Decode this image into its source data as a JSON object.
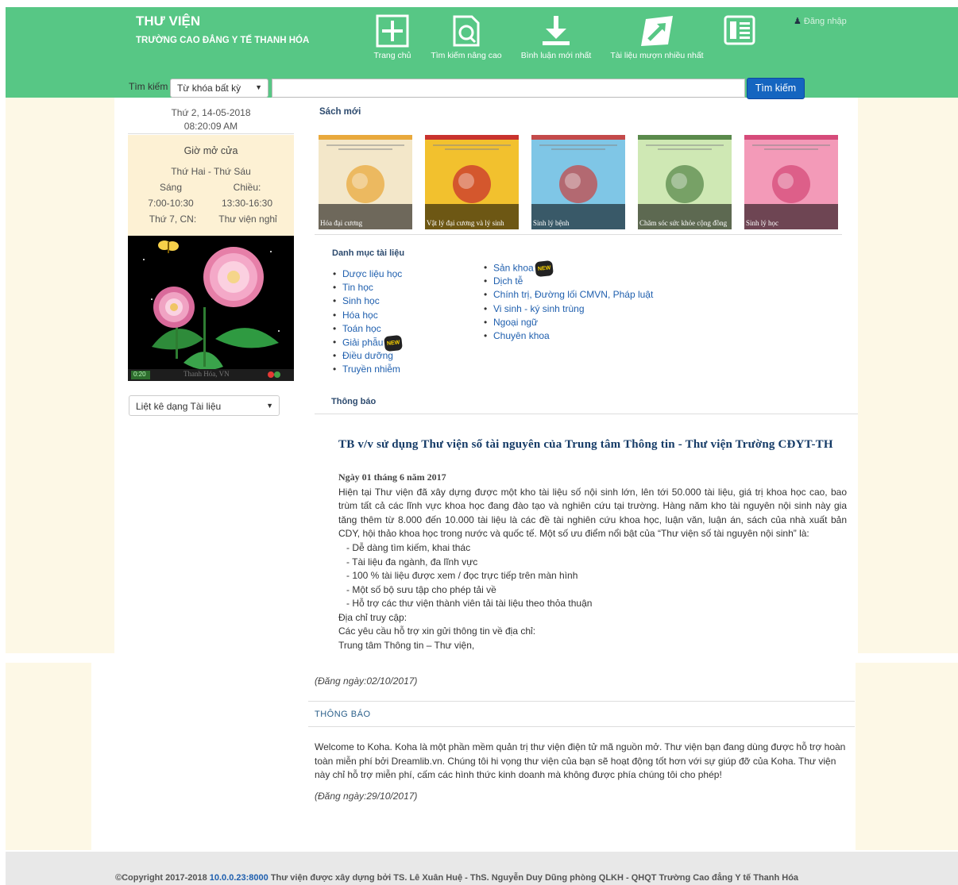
{
  "header": {
    "title": "THƯ VIỆN",
    "subtitle": "TRƯỜNG CAO ĐẲNG Y TẾ THANH HÓA",
    "nav": [
      {
        "label": "Trang chủ",
        "icon": "home-plus-icon"
      },
      {
        "label": "Tìm kiếm nâng cao",
        "icon": "advanced-search-icon"
      },
      {
        "label": "Bình luận mới nhất",
        "icon": "download-icon"
      },
      {
        "label": "Tài liệu mượn nhiều nhất",
        "icon": "trending-arrow-icon"
      },
      {
        "label": "",
        "icon": "newspaper-icon"
      }
    ],
    "login": "Đăng nhập"
  },
  "search": {
    "label": "Tìm kiếm",
    "scope": "Từ khóa bất kỳ",
    "query": "",
    "button": "Tìm kiếm"
  },
  "sidebar": {
    "date": "Thứ 2, 14-05-2018",
    "time": "08:20:09 AM",
    "hours_title": "Giờ mở cửa",
    "weekdays": "Thứ Hai - Thứ Sáu",
    "morning_label": "Sáng",
    "afternoon_label": "Chiều:",
    "morning_hours": "7:00-10:30",
    "afternoon_hours": "13:30-16:30",
    "weekend": "Thứ 7, CN:",
    "weekend_status": "Thư viện nghỉ",
    "clock_time": "0:20",
    "player_caption": "Thanh Hóa, VN",
    "doc_type_select": "Liệt kê dạng Tài liệu"
  },
  "new_books": {
    "title": "Sách mới",
    "items": [
      {
        "caption": "Hóa đại cương",
        "cover": "#f3e7c9",
        "accent": "#e9a93c"
      },
      {
        "caption": "Vật lý đại cương và lý sinh",
        "cover": "#f2c12e",
        "accent": "#c9332e"
      },
      {
        "caption": "Sinh lý bệnh",
        "cover": "#7fc6e6",
        "accent": "#c44a4a"
      },
      {
        "caption": "Chăm sóc sức khỏe cộng đồng",
        "cover": "#cfe8b4",
        "accent": "#5a8a4c"
      },
      {
        "caption": "Sinh lý học",
        "cover": "#f39ab8",
        "accent": "#d64b7a"
      }
    ]
  },
  "categories": {
    "title": "Danh mục tài liệu",
    "col1": [
      "Dược liệu học",
      "Tin học",
      "Sinh học",
      "Hóa học",
      "Toán học",
      "Giải phẫu",
      "Điều dưỡng",
      "Truyền nhiễm"
    ],
    "col2": [
      "Sản khoa",
      "Dịch tễ",
      "Chính trị, Đường lối CMVN, Pháp luật",
      "Vi sinh - ký sinh trùng",
      "Ngoại ngữ",
      "Chuyên khoa"
    ],
    "new_badge": "NEW"
  },
  "notice": {
    "section_title": "Thông báo",
    "title": "TB v/v sử dụng Thư viện số tài nguyên của Trung tâm Thông tin - Thư viện Trường CĐYT-TH",
    "date": "Ngày 01 tháng 6 năm 2017",
    "body": "Hiện tại Thư viện  đã xây dựng được một kho tài liệu số nội sinh lớn, lên tới 50.000 tài liệu, giá trị khoa học cao, bao trùm tất cả các lĩnh vực khoa học đang đào tạo và nghiên cứu tại trường.  Hàng năm kho tài nguyên nội sinh này gia tăng thêm từ 8.000 đến 10.000 tài liệu là các đề tài nghiên cứu khoa học, luận văn, luận án, sách của nhà xuất bản CDY, hội thảo khoa học trong nước và quốc tế. Một số ưu điểm nổi bật của “Thư viện số tài nguyên nội sinh” là:",
    "bullets": [
      "- Dễ dàng tìm kiếm, khai thác",
      "- Tài liệu đa ngành, đa lĩnh vực",
      "- 100 % tài liệu được xem / đọc trực tiếp trên màn hình",
      "- Một số bộ sưu tập cho phép tải về",
      "- Hỗ trợ các thư viện thành viên tải tài liệu theo thỏa thuận"
    ],
    "access": "Địa chỉ truy cập:",
    "support": "Các yêu cầu hỗ trợ xin gửi thông tin về địa chỉ:",
    "center": "Trung tâm Thông tin – Thư viện,",
    "posted": "(Đăng ngày:02/10/2017)"
  },
  "notice2": {
    "title": "THÔNG BÁO",
    "body": "Welcome to Koha. Koha là một phần mềm quản trị thư viện điện tử mã nguồn mở. Thư viện bạn đang dùng được hỗ trợ hoàn toàn miễn phí bởi Dreamlib.vn. Chúng tôi hi vọng thư viện của bạn sẽ hoạt động tốt hơn với sự giúp đỡ của Koha. Thư viện này chỉ hỗ trợ miễn phí, cấm các hình thức kinh doanh mà không được phía chúng tôi cho phép!",
    "posted": "(Đăng ngày:29/10/2017)"
  },
  "footer": {
    "prefix": "©Copyright 2017-2018 ",
    "link": "10.0.0.23:8000",
    "suffix": " Thư viện được xây dựng bởi TS. Lê Xuân Huệ - ThS. Nguyễn Duy Dũng phòng QLKH - QHQT Trường Cao đẳng Y tế Thanh Hóa"
  },
  "colors": {
    "header_green": "#57c785",
    "button_blue": "#1565c0",
    "page_cream": "#fdf8e6",
    "link_blue": "#1f5fae"
  }
}
